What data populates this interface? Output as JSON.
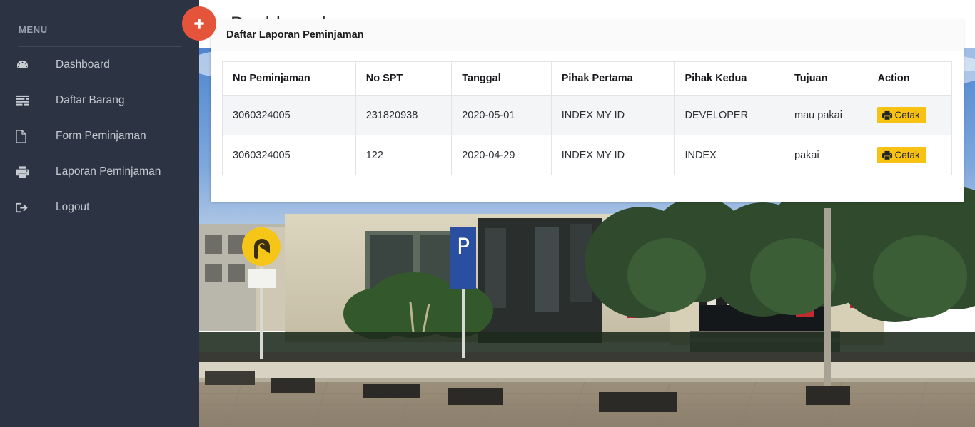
{
  "sidebar": {
    "menu_label": "MENU",
    "items": [
      {
        "label": "Dashboard",
        "icon": "tachometer-icon",
        "name": "sidebar-item-dashboard"
      },
      {
        "label": "Daftar Barang",
        "icon": "list-icon",
        "name": "sidebar-item-daftar-barang"
      },
      {
        "label": "Form Peminjaman",
        "icon": "file-icon",
        "name": "sidebar-item-form-peminjaman"
      },
      {
        "label": "Laporan Peminjaman",
        "icon": "print-icon",
        "name": "sidebar-item-laporan-peminjaman"
      },
      {
        "label": "Logout",
        "icon": "logout-icon",
        "name": "sidebar-item-logout"
      }
    ],
    "background_color": "#2c3342",
    "text_color": "#c3c8d0"
  },
  "topbar": {
    "title": "Dashboard",
    "toggle_icon": "plus-icon",
    "toggle_color": "#e4543a"
  },
  "panel": {
    "title": "Daftar Laporan Peminjaman",
    "table": {
      "columns": [
        "No Peminjaman",
        "No SPT",
        "Tanggal",
        "Pihak Pertama",
        "Pihak Kedua",
        "Tujuan",
        "Action"
      ],
      "rows": [
        {
          "no_peminjaman": "3060324005",
          "no_spt": "231820938",
          "tanggal": "2020-05-01",
          "pihak_pertama": "INDEX MY ID",
          "pihak_kedua": "DEVELOPER",
          "tujuan": "mau pakai",
          "action_label": "Cetak",
          "action_icon": "print-icon"
        },
        {
          "no_peminjaman": "3060324005",
          "no_spt": "122",
          "tanggal": "2020-04-29",
          "pihak_pertama": "INDEX MY ID",
          "pihak_kedua": "INDEX",
          "tujuan": "pakai",
          "action_label": "Cetak",
          "action_icon": "print-icon"
        }
      ]
    },
    "action_button_color": "#f8c212"
  },
  "background": {
    "description": "photo of campus building with trees, road signs and paved courtyard under blue sky",
    "sky_color": "#5b8fd4",
    "pavement_color": "#9e917e"
  }
}
